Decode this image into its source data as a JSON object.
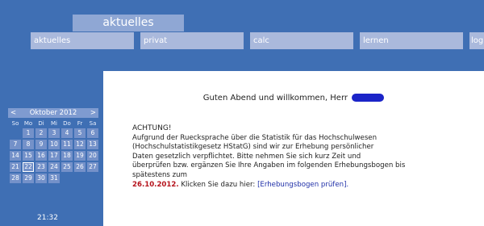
{
  "header": {
    "title": "aktuelles"
  },
  "nav": {
    "items": [
      "aktuelles",
      "privat",
      "calc",
      "lernen",
      "log"
    ]
  },
  "greeting": {
    "text": "Guten Abend und willkommen, Herr"
  },
  "message": {
    "heading": "ACHTUNG!",
    "lines": [
      "Aufgrund der Ruecksprache über die Statistik für das Hochschulwesen",
      "(Hochschulstatistikgesetz HStatG) sind wir zur Erhebung persönlicher",
      "Daten gesetzlich verpflichtet. Bitte nehmen Sie sich kurz Zeit und",
      "überprüfen bzw. ergänzen Sie Ihre Angaben im folgenden Erhebungsbogen bis",
      "spätestens zum"
    ],
    "date": "26.10.2012.",
    "pre_link": "Klicken Sie dazu hier:",
    "link": "[Erhebungsbogen prüfen]."
  },
  "calendar": {
    "prev": "<",
    "title": "Oktober 2012",
    "next": ">",
    "weekdays": [
      "So",
      "Mo",
      "Di",
      "Mi",
      "Do",
      "Fr",
      "Sa"
    ],
    "days": [
      "",
      "1",
      "2",
      "3",
      "4",
      "5",
      "6",
      "7",
      "8",
      "9",
      "10",
      "11",
      "12",
      "13",
      "14",
      "15",
      "16",
      "17",
      "18",
      "19",
      "20",
      "21",
      "22",
      "23",
      "24",
      "25",
      "26",
      "27",
      "28",
      "29",
      "30",
      "31",
      "",
      "",
      ""
    ],
    "today": "22"
  },
  "clock": {
    "time": "21:32"
  },
  "colors": {
    "background": "#3f6fb4",
    "accent": "#8fa7d4",
    "deadline": "#b5121b",
    "link": "#2030a8"
  }
}
